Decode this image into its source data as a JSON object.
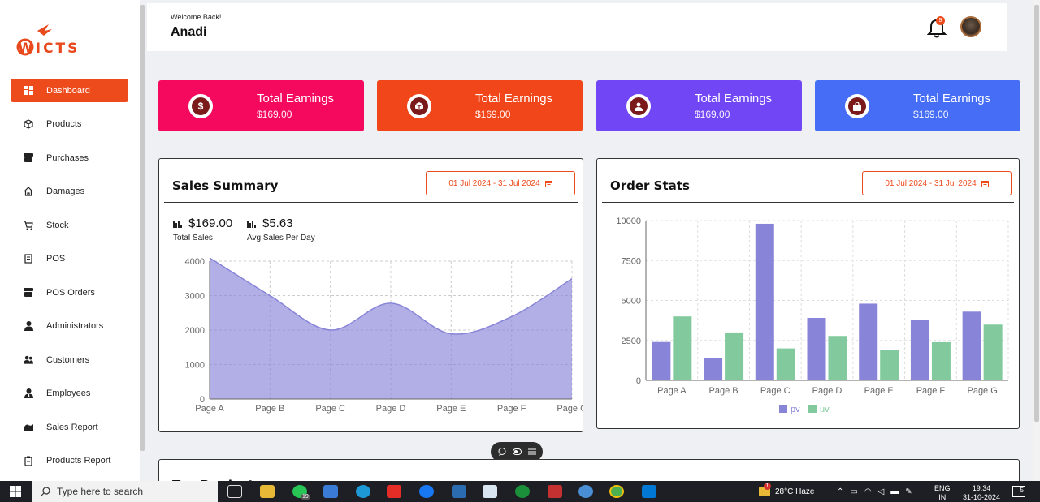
{
  "brand": {
    "logo_text": "WICTS"
  },
  "sidebar": {
    "items": [
      {
        "label": "Dashboard",
        "icon": "grid-icon",
        "active": true
      },
      {
        "label": "Products",
        "icon": "cube-icon"
      },
      {
        "label": "Purchases",
        "icon": "archive-icon"
      },
      {
        "label": "Damages",
        "icon": "home-icon"
      },
      {
        "label": "Stock",
        "icon": "cart-icon"
      },
      {
        "label": "POS",
        "icon": "receipt-icon"
      },
      {
        "label": "POS Orders",
        "icon": "archive-icon"
      },
      {
        "label": "Administrators",
        "icon": "user-icon"
      },
      {
        "label": "Customers",
        "icon": "users-icon"
      },
      {
        "label": "Employees",
        "icon": "user-tie-icon"
      },
      {
        "label": "Sales Report",
        "icon": "chart-icon"
      },
      {
        "label": "Products Report",
        "icon": "clipboard-icon"
      }
    ]
  },
  "header": {
    "welcome": "Welcome Back!",
    "user_name": "Anadi",
    "notification_count": "9"
  },
  "cards": [
    {
      "title": "Total Earnings",
      "value": "$169.00",
      "color": "#f5095f",
      "icon": "dollar-icon"
    },
    {
      "title": "Total Earnings",
      "value": "$169.00",
      "color": "#f0461a",
      "icon": "box-icon"
    },
    {
      "title": "Total Earnings",
      "value": "$169.00",
      "color": "#7146f5",
      "icon": "user-icon"
    },
    {
      "title": "Total Earnings",
      "value": "$169.00",
      "color": "#466df5",
      "icon": "bag-icon"
    }
  ],
  "sales_summary": {
    "title": "Sales Summary",
    "date_range": "01 Jul 2024 - 31 Jul 2024",
    "total_sales_value": "$169.00",
    "total_sales_label": "Total Sales",
    "avg_sales_value": "$5.63",
    "avg_sales_label": "Avg Sales Per Day"
  },
  "order_stats": {
    "title": "Order Stats",
    "date_range": "01 Jul 2024 - 31 Jul 2024"
  },
  "bottom_panel": {
    "title": "Top Products"
  },
  "chart_data": [
    {
      "type": "area",
      "categories": [
        "Page A",
        "Page B",
        "Page C",
        "Page D",
        "Page E",
        "Page F",
        "Page G"
      ],
      "series": [
        {
          "values": [
            4100,
            3000,
            2000,
            2780,
            1890,
            2390,
            3490
          ]
        }
      ],
      "ylim": [
        0,
        4000
      ],
      "yticks": [
        0,
        1000,
        2000,
        3000,
        4000
      ],
      "grid": true,
      "color": "#8884d8"
    },
    {
      "type": "bar",
      "categories": [
        "Page A",
        "Page B",
        "Page C",
        "Page D",
        "Page E",
        "Page F",
        "Page G"
      ],
      "series": [
        {
          "name": "pv",
          "values": [
            2400,
            1398,
            9800,
            3908,
            4800,
            3800,
            4300
          ],
          "color": "#8884d8"
        },
        {
          "name": "uv",
          "values": [
            4000,
            3000,
            2000,
            2780,
            1890,
            2390,
            3490
          ],
          "color": "#82ca9d"
        }
      ],
      "ylim": [
        0,
        10000
      ],
      "yticks": [
        0,
        2500,
        5000,
        7500,
        10000
      ],
      "grid": true,
      "legend": "bottom"
    }
  ],
  "taskbar": {
    "search_placeholder": "Type here to search",
    "whatsapp_badge": "19",
    "weather_badge": "1",
    "weather": "28°C  Haze",
    "lang_top": "ENG",
    "lang_bottom": "IN",
    "time": "19:34",
    "date": "31-10-2024",
    "notif_count": "5"
  }
}
